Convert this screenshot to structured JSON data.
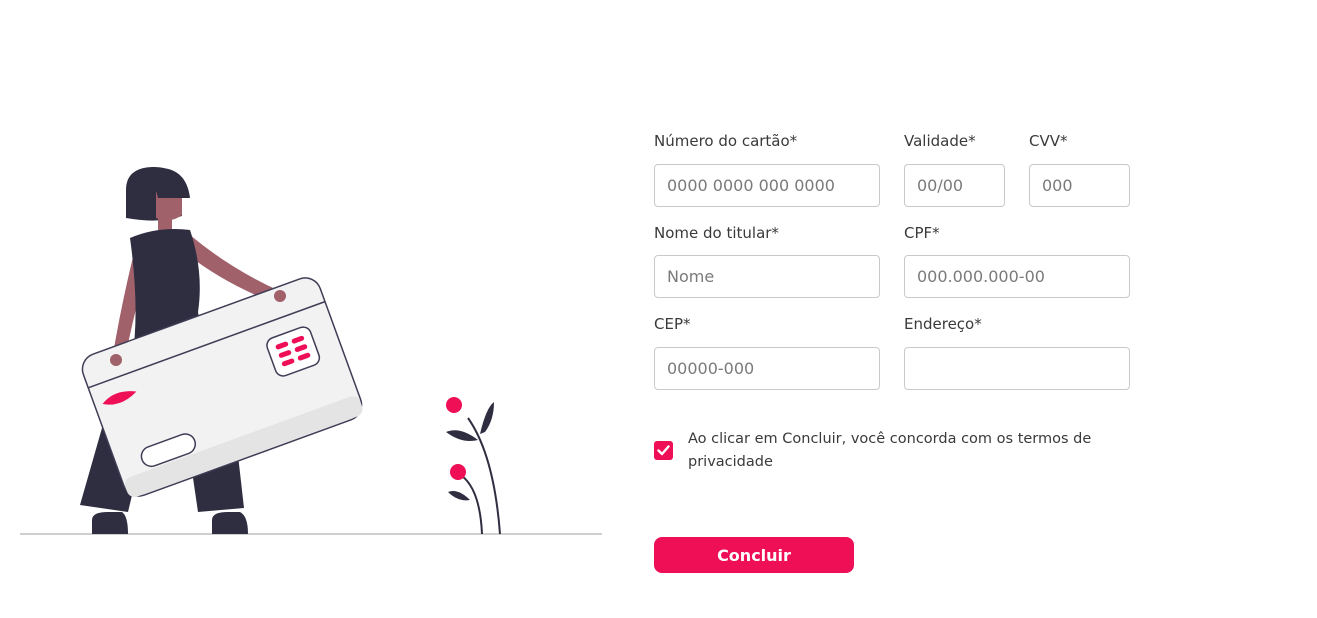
{
  "colors": {
    "accent": "#ee0f57",
    "dark": "#2f2e41",
    "skin": "#a0616a"
  },
  "form": {
    "card_number": {
      "label": "Número do cartão*",
      "placeholder": "0000 0000 000 0000"
    },
    "validity": {
      "label": "Validade*",
      "placeholder": "00/00"
    },
    "cvv": {
      "label": "CVV*",
      "placeholder": "000"
    },
    "holder_name": {
      "label": "Nome do titular*",
      "placeholder": "Nome"
    },
    "cpf": {
      "label": "CPF*",
      "placeholder": "000.000.000-00"
    },
    "cep": {
      "label": "CEP*",
      "placeholder": "00000-000"
    },
    "address": {
      "label": "Endereço*",
      "placeholder": ""
    },
    "terms": {
      "checked": true,
      "text": "Ao clicar em Concluir, você concorda com os termos de privacidade"
    },
    "submit_label": "Concluir"
  },
  "illustration": {
    "icon": "woman-holding-credit-card-illustration"
  }
}
